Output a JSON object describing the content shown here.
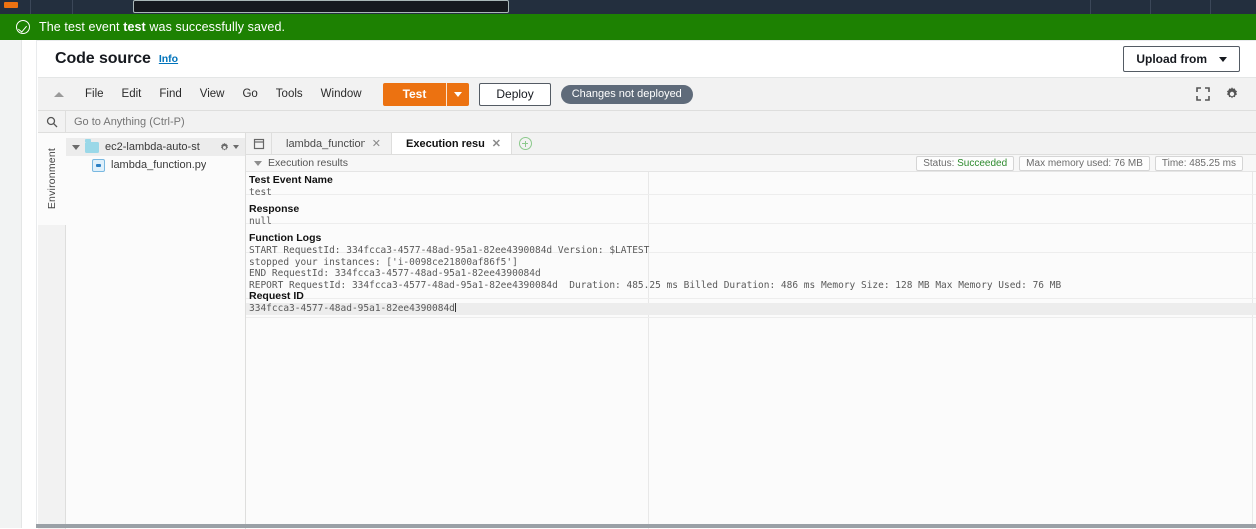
{
  "topbar": {
    "search_placeholder": ""
  },
  "flash": {
    "icon": "check-circle-icon",
    "text_before": "The test event ",
    "text_bold": "test",
    "text_after": " was successfully saved.",
    "background": "#1d8102"
  },
  "card": {
    "title": "Code source",
    "info_label": "Info",
    "upload_from_label": "Upload from"
  },
  "menubar": {
    "items": [
      {
        "label": "File"
      },
      {
        "label": "Edit"
      },
      {
        "label": "Find"
      },
      {
        "label": "View"
      },
      {
        "label": "Go"
      },
      {
        "label": "Tools"
      },
      {
        "label": "Window"
      }
    ],
    "test_label": "Test",
    "deploy_label": "Deploy",
    "changes_badge": "Changes not deployed",
    "accent_orange": "#ec7211",
    "right_icons": [
      "fullscreen-icon",
      "gear-icon"
    ]
  },
  "goto": {
    "search_icon": "search-icon",
    "placeholder": "Go to Anything (Ctrl-P)",
    "value": ""
  },
  "environment": {
    "rail_label": "Environment",
    "tree": {
      "folder": "ec2-lambda-auto-st",
      "file": "lambda_function.py"
    }
  },
  "editor": {
    "tabs": [
      {
        "label": "lambda_function",
        "active": false
      },
      {
        "label": "Execution result:",
        "active": true
      }
    ],
    "new_tab_icon": "plus-circle-icon",
    "panel_icon": "panel-toggle-icon"
  },
  "execution": {
    "strip_label": "Execution results",
    "badges": [
      {
        "label_prefix": "Status: ",
        "label_value": "Succeeded",
        "state": "ok"
      },
      {
        "label_prefix": "",
        "label_value": "Max memory used: 76 MB",
        "state": "plain"
      },
      {
        "label_prefix": "",
        "label_value": "Time: 485.25 ms",
        "state": "plain"
      }
    ],
    "sections": [
      {
        "heading": "Test Event Name",
        "body": "test"
      },
      {
        "heading": "Response",
        "body": "null"
      },
      {
        "heading": "Function Logs",
        "body": "START RequestId: 334fcca3-4577-48ad-95a1-82ee4390084d Version: $LATEST\nstopped your instances: ['i-0098ce21800af86f5']\nEND RequestId: 334fcca3-4577-48ad-95a1-82ee4390084d\nREPORT RequestId: 334fcca3-4577-48ad-95a1-82ee4390084d  Duration: 485.25 ms Billed Duration: 486 ms Memory Size: 128 MB Max Memory Used: 76 MB"
      },
      {
        "heading": "Request ID",
        "body": "334fcca3-4577-48ad-95a1-82ee4390084d"
      }
    ]
  }
}
